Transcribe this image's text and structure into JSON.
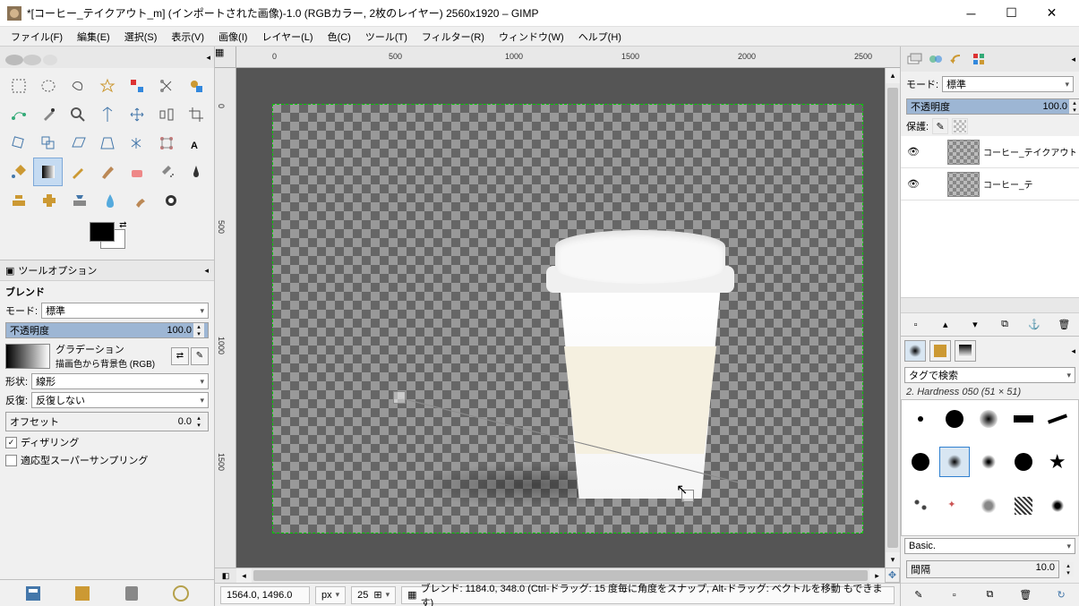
{
  "title": "*[コーヒー_テイクアウト_m] (インポートされた画像)-1.0 (RGBカラー, 2枚のレイヤー) 2560x1920 – GIMP",
  "menu": [
    "ファイル(F)",
    "編集(E)",
    "選択(S)",
    "表示(V)",
    "画像(I)",
    "レイヤー(L)",
    "色(C)",
    "ツール(T)",
    "フィルター(R)",
    "ウィンドウ(W)",
    "ヘルプ(H)"
  ],
  "tool_options_title": "ツールオプション",
  "blend_label": "ブレンド",
  "mode_label": "モード:",
  "mode_value": "標準",
  "opacity_label": "不透明度",
  "opacity_value": "100.0",
  "gradation_label": "グラデーション",
  "gradation_value": "描画色から背景色 (RGB)",
  "shape_label": "形状:",
  "shape_value": "線形",
  "repeat_label": "反復:",
  "repeat_value": "反復しない",
  "offset_label": "オフセット",
  "offset_value": "0.0",
  "dither_label": "ディザリング",
  "supersample_label": "適応型スーパーサンプリング",
  "ruler_h": [
    "0",
    "500",
    "1000",
    "1500",
    "2000",
    "2500"
  ],
  "ruler_v": [
    "0",
    "500",
    "1000",
    "1500"
  ],
  "status_coords": "1564.0, 1496.0",
  "status_unit": "px",
  "status_zoom": "25",
  "status_msg": "ブレンド: 1184.0, 348.0 (Ctrl-ドラッグ: 15 度毎に角度をスナップ, Alt-ドラッグ: ベクトルを移動 もできます)",
  "rp_mode_label": "モード:",
  "rp_mode_value": "標準",
  "rp_opacity_label": "不透明度",
  "rp_opacity_value": "100.0",
  "rp_lock_label": "保護:",
  "layers": [
    {
      "name": "コーヒー_テイクアウト",
      "eye": true
    },
    {
      "name": "コーヒー_テ",
      "eye": true
    }
  ],
  "brush_tag_label": "タグで検索",
  "brush_info": "2. Hardness 050 (51 × 51)",
  "brush_preset_label": "Basic.",
  "brush_spacing_label": "間隔",
  "brush_spacing_value": "10.0"
}
